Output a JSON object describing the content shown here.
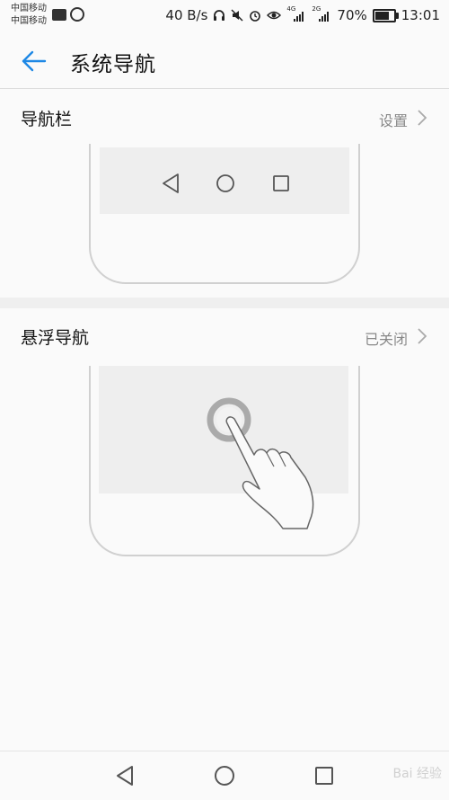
{
  "status_bar": {
    "carriers": [
      "中国移动",
      "中国移动"
    ],
    "speed": "40 B/s",
    "network_tags": [
      "4G",
      "2G"
    ],
    "battery": "70%",
    "battery_level": 0.7,
    "time": "13:01"
  },
  "header": {
    "title": "系统导航"
  },
  "sections": [
    {
      "label": "导航栏",
      "status": "设置"
    },
    {
      "label": "悬浮导航",
      "status": "已关闭"
    }
  ],
  "bottom_nav": {
    "icons": [
      "back-triangle-icon",
      "home-circle-icon",
      "recent-square-icon"
    ]
  },
  "colors": {
    "accent": "#1e88e5",
    "illustration_stroke": "#d0d0d0",
    "illustration_fill": "#eeeeee",
    "float_ring": "#aaaaaa"
  },
  "watermark": "Bai 经验"
}
